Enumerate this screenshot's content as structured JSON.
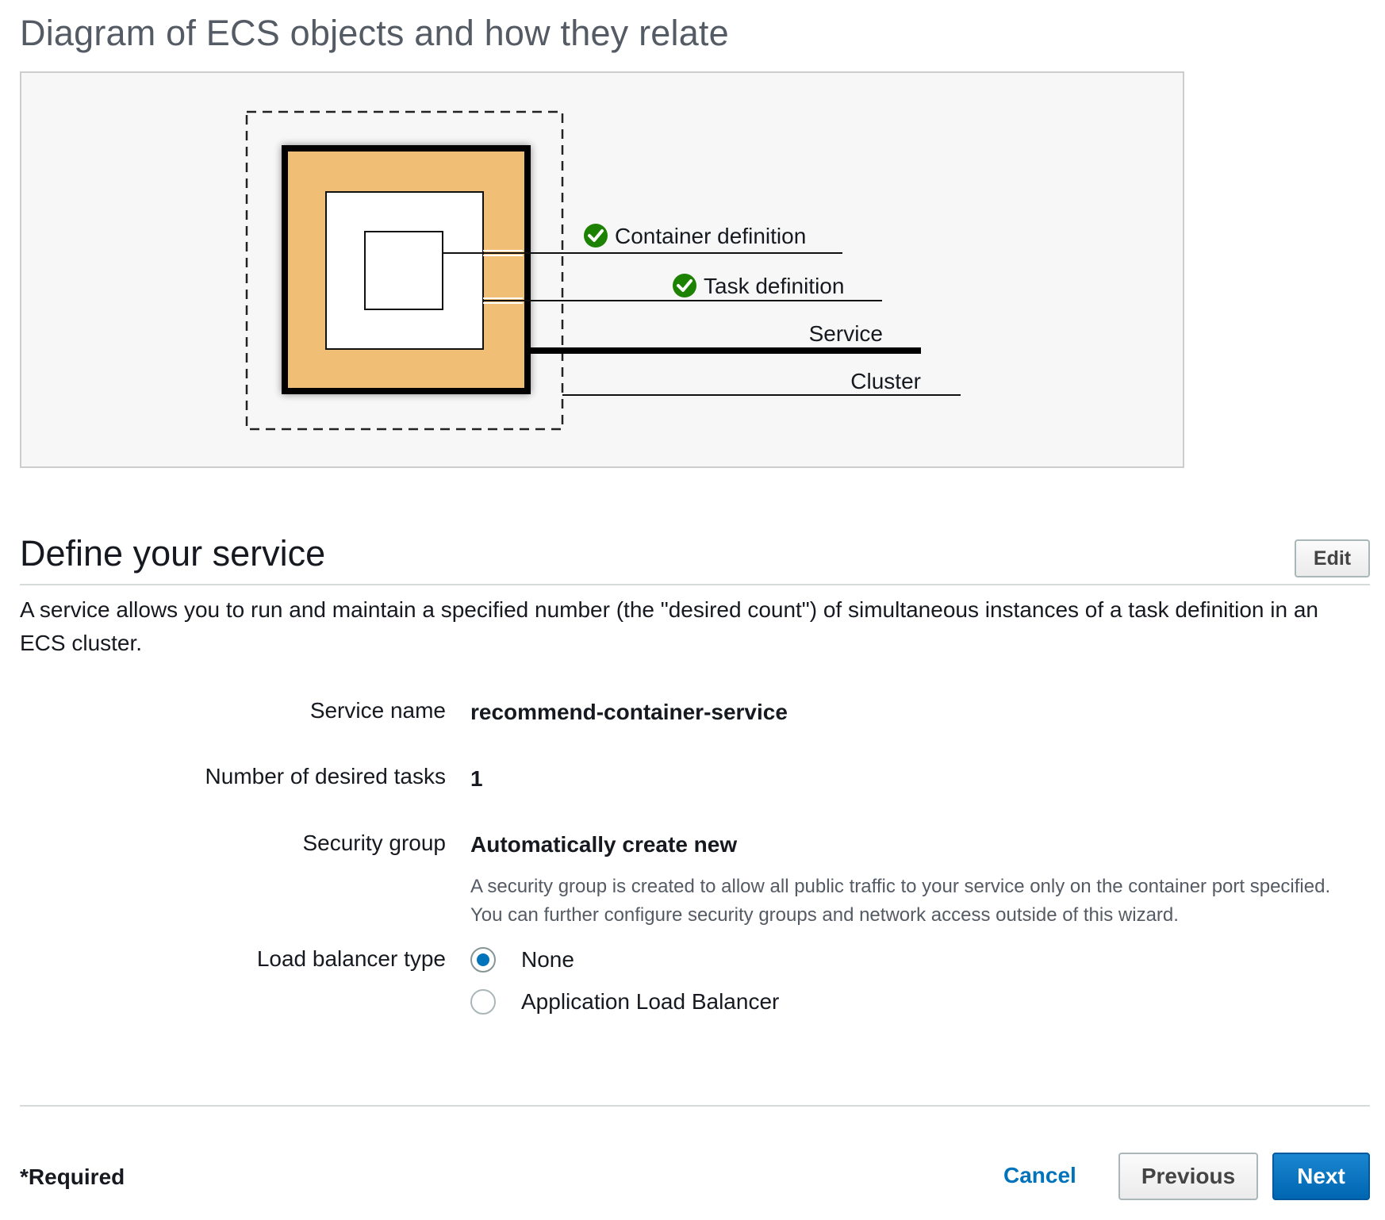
{
  "diagram": {
    "title": "Diagram of ECS objects and how they relate",
    "labels": {
      "container_definition": "Container definition",
      "task_definition": "Task definition",
      "service": "Service",
      "cluster": "Cluster"
    },
    "colors": {
      "service_fill": "#f0bf74",
      "check_green": "#1d8102",
      "panel_bg": "#f7f7f7"
    },
    "icons": {
      "container_check": "check-circle-icon",
      "task_check": "check-circle-icon"
    }
  },
  "section": {
    "title": "Define your service",
    "edit_label": "Edit",
    "description": "A service allows you to run and maintain a specified number (the \"desired count\") of simultaneous instances of a task definition in an ECS cluster."
  },
  "fields": {
    "service_name": {
      "label": "Service name",
      "value": "recommend-container-service"
    },
    "desired_tasks": {
      "label": "Number of desired tasks",
      "value": "1"
    },
    "security_group": {
      "label": "Security group",
      "value": "Automatically create new",
      "help": "A security group is created to allow all public traffic to your service only on the container port specified. You can further configure security groups and network access outside of this wizard."
    },
    "load_balancer": {
      "label": "Load balancer type",
      "options": [
        "None",
        "Application Load Balancer"
      ],
      "selected": "None"
    }
  },
  "footer": {
    "required_note": "*Required",
    "cancel_label": "Cancel",
    "previous_label": "Previous",
    "next_label": "Next",
    "accent_color": "#0073bb"
  }
}
